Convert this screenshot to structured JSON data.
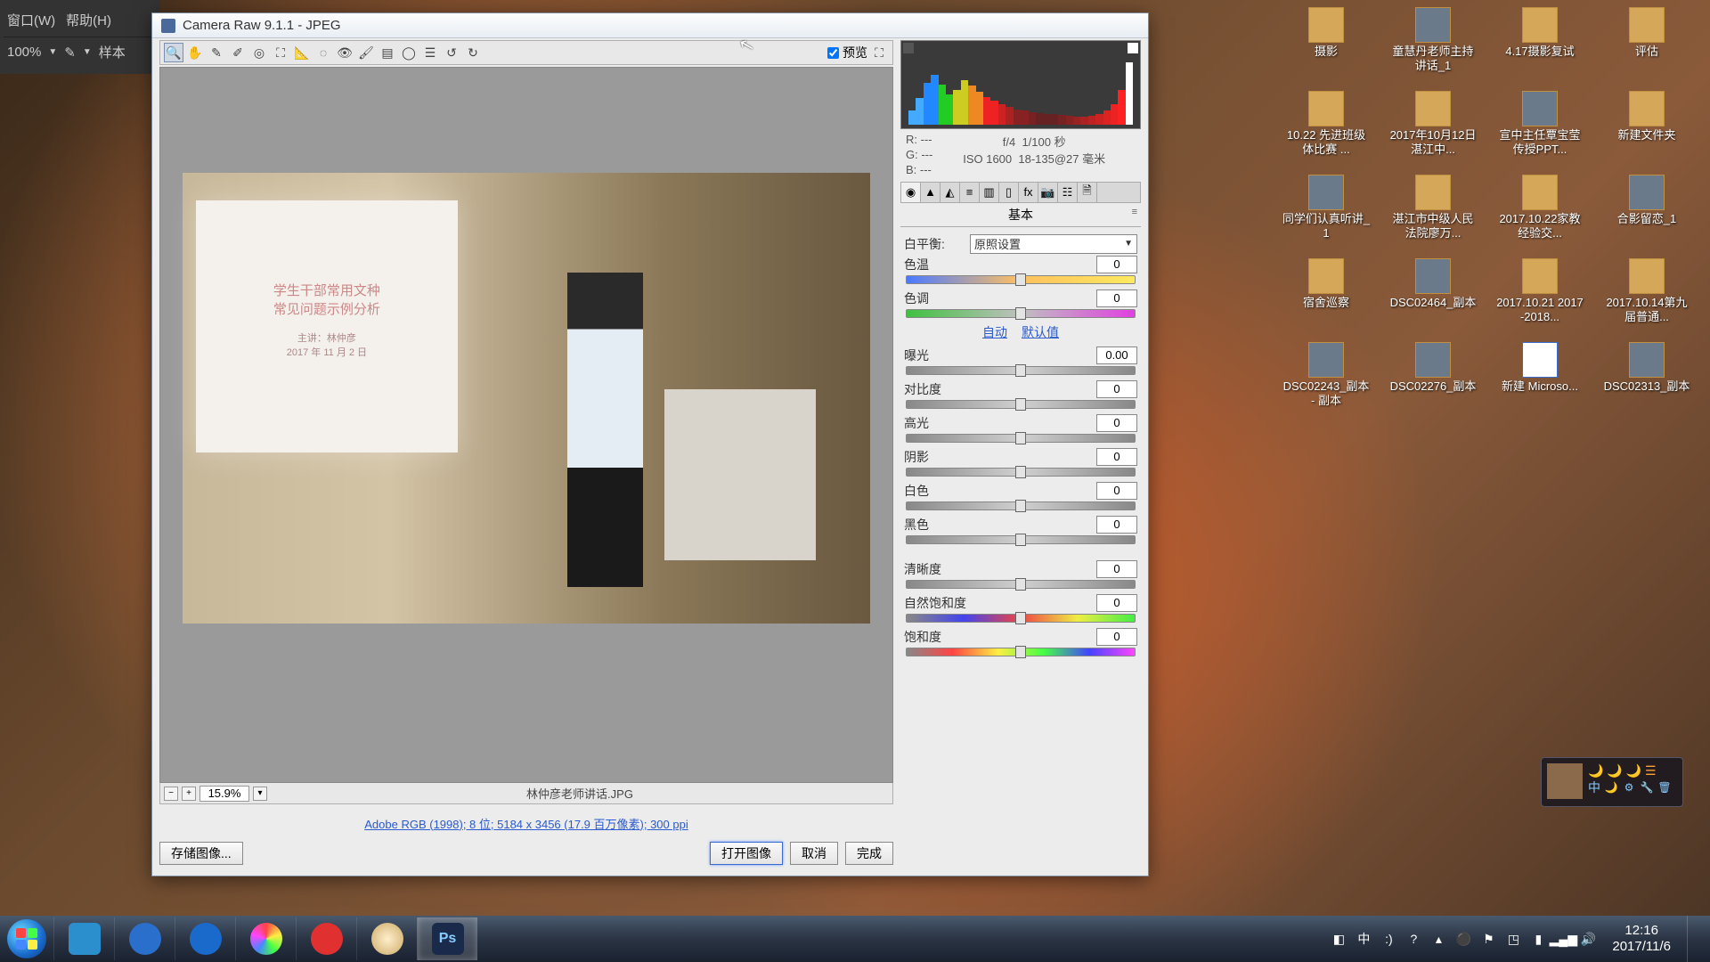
{
  "ps": {
    "menu_window": "窗口(W)",
    "menu_help": "帮助(H)",
    "zoom": "100%",
    "sample": "样本"
  },
  "cr": {
    "title": "Camera Raw 9.1.1  -  JPEG",
    "preview_label": "预览",
    "zoom_value": "15.9%",
    "filename": "林仲彦老师讲话.JPG",
    "meta_link": "Adobe RGB (1998); 8 位; 5184 x 3456 (17.9 百万像素); 300 ppi",
    "btn_save": "存储图像...",
    "btn_open": "打开图像",
    "btn_cancel": "取消",
    "btn_done": "完成",
    "exif": {
      "r": "R:  ---",
      "g": "G:  ---",
      "b": "B:  ---",
      "aperture": "f/4",
      "shutter": "1/100 秒",
      "iso": "ISO 1600",
      "lens": "18-135@27 毫米"
    },
    "proj_line1": "学生干部常用文种",
    "proj_line2": "常见问题示例分析",
    "proj_line3": "主讲：林仲彦",
    "proj_line4": "2017 年 11 月 2 日",
    "panel_title": "基本",
    "wb_label": "白平衡:",
    "wb_value": "原照设置",
    "auto": "自动",
    "default": "默认值",
    "sliders": {
      "temp": {
        "label": "色温",
        "val": "0"
      },
      "tint": {
        "label": "色调",
        "val": "0"
      },
      "exposure": {
        "label": "曝光",
        "val": "0.00"
      },
      "contrast": {
        "label": "对比度",
        "val": "0"
      },
      "highlights": {
        "label": "高光",
        "val": "0"
      },
      "shadows": {
        "label": "阴影",
        "val": "0"
      },
      "whites": {
        "label": "白色",
        "val": "0"
      },
      "blacks": {
        "label": "黑色",
        "val": "0"
      },
      "clarity": {
        "label": "清晰度",
        "val": "0"
      },
      "vibrance": {
        "label": "自然饱和度",
        "val": "0"
      },
      "saturation": {
        "label": "饱和度",
        "val": "0"
      }
    }
  },
  "desktop": [
    {
      "lbl": "评估",
      "t": "folder"
    },
    {
      "lbl": "4.17摄影复试",
      "t": "folder"
    },
    {
      "lbl": "童慧丹老师主持讲话_1",
      "t": "img"
    },
    {
      "lbl": "摄影",
      "t": "folder"
    },
    {
      "lbl": "新建文件夹",
      "t": "folder"
    },
    {
      "lbl": "宣中主任覃宝莹传授PPT...",
      "t": "img"
    },
    {
      "lbl": "2017年10月12日湛江中...",
      "t": "folder"
    },
    {
      "lbl": "10.22 先进班级体比赛 ...",
      "t": "folder"
    },
    {
      "lbl": "合影留恋_1",
      "t": "img"
    },
    {
      "lbl": "2017.10.22家教经验交...",
      "t": "folder"
    },
    {
      "lbl": "湛江市中级人民法院廖万...",
      "t": "folder"
    },
    {
      "lbl": "同学们认真听讲_1",
      "t": "img"
    },
    {
      "lbl": "2017.10.14第九届普通...",
      "t": "folder"
    },
    {
      "lbl": "2017.10.21 2017-2018...",
      "t": "folder"
    },
    {
      "lbl": "DSC02464_副本",
      "t": "img"
    },
    {
      "lbl": "宿舍巡察",
      "t": "folder"
    },
    {
      "lbl": "DSC02313_副本",
      "t": "img"
    },
    {
      "lbl": "新建 Microso...",
      "t": "doc"
    },
    {
      "lbl": "DSC02276_副本",
      "t": "img"
    },
    {
      "lbl": "DSC02243_副本 - 副本",
      "t": "img"
    }
  ],
  "gadget": {
    "ime": "中"
  },
  "tray": {
    "ime": "中",
    "time": "12:16",
    "date": "2017/11/6"
  }
}
